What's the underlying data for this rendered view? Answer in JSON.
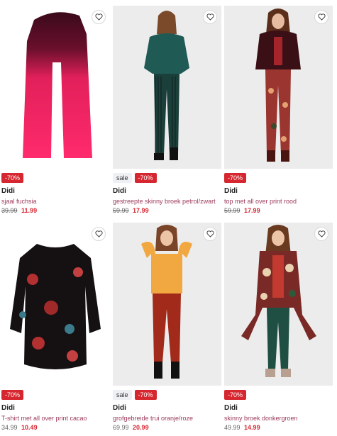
{
  "products": [
    {
      "discount": "-70%",
      "sale": "",
      "brand": "Didi",
      "title": "sjaal fuchsia",
      "old_price": "39.99",
      "new_price": "11.99",
      "old_strike": true
    },
    {
      "discount": "-70%",
      "sale": "sale",
      "brand": "Didi",
      "title": "gestreepte skinny broek petrol/zwart",
      "old_price": "59.99",
      "new_price": "17.99",
      "old_strike": true
    },
    {
      "discount": "-70%",
      "sale": "",
      "brand": "Didi",
      "title": "top met all over print rood",
      "old_price": "59.99",
      "new_price": "17.99",
      "old_strike": true
    },
    {
      "discount": "-70%",
      "sale": "",
      "brand": "Didi",
      "title": "T-shirt met all over print cacao",
      "old_price": "34.99",
      "new_price": "10.49",
      "old_strike": false
    },
    {
      "discount": "-70%",
      "sale": "sale",
      "brand": "Didi",
      "title": "grofgebreide trui oranje/roze",
      "old_price": "69.99",
      "new_price": "20.99",
      "old_strike": false
    },
    {
      "discount": "-70%",
      "sale": "",
      "brand": "Didi",
      "title": "skinny broek donkergroen",
      "old_price": "49.99",
      "new_price": "14.99",
      "old_strike": false
    }
  ],
  "colors": {
    "discount": "#d6262f",
    "title": "#9a3a5a"
  },
  "icons": {
    "wishlist": "heart-outline-icon"
  }
}
